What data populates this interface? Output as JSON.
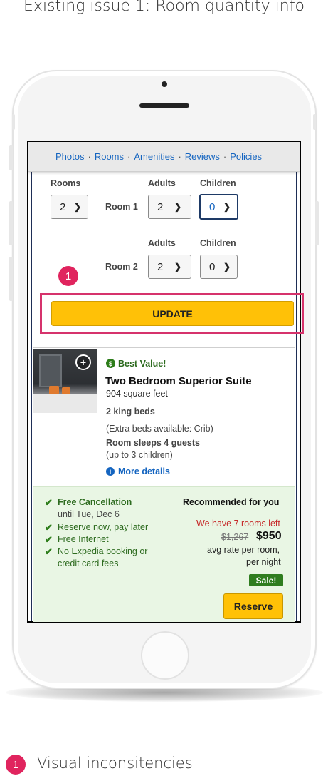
{
  "heading": "Existing issue 1: Room quantity info",
  "nav": {
    "links": [
      "Photos",
      "Rooms",
      "Amenities",
      "Reviews",
      "Policies"
    ],
    "separator": "·"
  },
  "room_form": {
    "rooms_label": "Rooms",
    "rooms_value": "2",
    "adults_label": "Adults",
    "children_label": "Children",
    "rows": [
      {
        "label": "Room 1",
        "adults": "2",
        "children": "0"
      },
      {
        "label": "Room 2",
        "adults": "2",
        "children": "0"
      }
    ],
    "update_label": "UPDATE"
  },
  "callout": {
    "number": "1"
  },
  "room_card": {
    "badge": "Best Value!",
    "badge_icon": "dollar-circle-icon",
    "title": "Two Bedroom Superior Suite",
    "area": "904 square feet",
    "beds": "2 king beds",
    "extra_beds": "(Extra beds available: Crib)",
    "sleeps": "Room sleeps 4 guests",
    "sleeps_detail": "(up to 3 children)",
    "more_details": "More details"
  },
  "offer": {
    "benefits": [
      {
        "text": "Free Cancellation",
        "bold": true
      },
      {
        "text": "Reserve now, pay later"
      },
      {
        "text": "Free Internet"
      },
      {
        "text": "No Expedia booking or"
      }
    ],
    "cancellation_until": "until Tue, Dec 6",
    "fees_line2": "credit card fees",
    "recommended": "Recommended for you",
    "rooms_left": "We have 7 rooms left",
    "old_price": "$1,267",
    "price": "$950",
    "price_note_1": "avg rate per room,",
    "price_note_2": "per night",
    "sale": "Sale!",
    "reserve_label": "Reserve"
  },
  "legend": {
    "number": "1",
    "text": "Visual inconsitencies"
  },
  "colors": {
    "accent": "#ffc107",
    "callout": "#e0245e",
    "link": "#1565c0",
    "green": "#2d6b1f",
    "alert": "#c62828"
  }
}
